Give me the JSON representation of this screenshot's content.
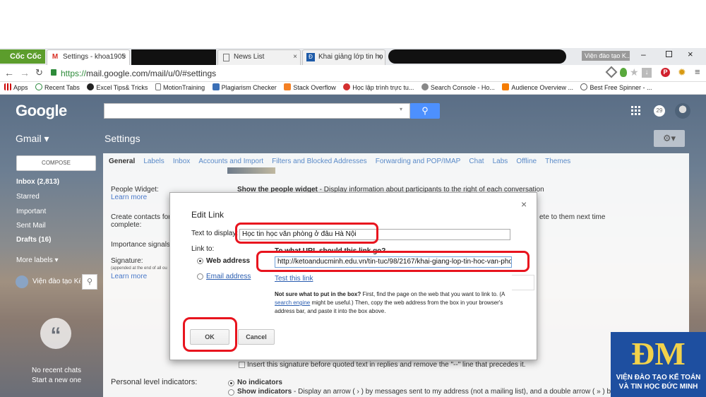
{
  "browser": {
    "tabs": [
      {
        "label": "Cốc Cốc"
      },
      {
        "label": "Settings - khoa1905"
      },
      {
        "label": "News List"
      },
      {
        "label": "Khai giảng lớp tin họ"
      }
    ],
    "profile_chip": "Viện đào tạo K...",
    "url_protocol": "https://",
    "url_rest": "mail.google.com/mail/u/0/#settings",
    "bookmarks": [
      "Apps",
      "Recent Tabs",
      "Excel Tips& Tricks",
      "MotionTraining",
      "Plagiarism Checker",
      "Stack Overflow",
      "Học lập trình trực tu...",
      "Search Console - Ho...",
      "Audience Overview ...",
      "Best Free Spinner - ..."
    ]
  },
  "gmail": {
    "logo": "Google",
    "app_switcher": "Gmail ▾",
    "page_title": "Settings",
    "notif_count": "29",
    "compose": "COMPOSE",
    "nav": [
      "Inbox (2,813)",
      "Starred",
      "Important",
      "Sent Mail",
      "Drafts (16)",
      "More labels ▾"
    ],
    "chat_user": "Viện đào tạo Kế",
    "no_chats": "No recent chats",
    "new_chat": "Start a new one",
    "settings_tabs": [
      "General",
      "Labels",
      "Inbox",
      "Accounts and Import",
      "Filters and Blocked Addresses",
      "Forwarding and POP/IMAP",
      "Chat",
      "Labs",
      "Offline",
      "Themes"
    ],
    "people_widget_label": "People Widget:",
    "people_widget_learn": "Learn more",
    "people_widget_opt_bold": "Show the people widget",
    "people_widget_opt_rest": " - Display information about participants to the right of each conversation",
    "create_contacts_label": "Create contacts for",
    "create_contacts_label2": "complete:",
    "create_contacts_rest": "ete to them next time",
    "importance_label": "Importance signals",
    "signature_label": "Signature:",
    "signature_note": "(appended at the end of all ou",
    "signature_learn": "Learn more",
    "insert_sig": "Insert this signature before quoted text in replies and remove the \"--\" line that precedes it.",
    "personal_label": "Personal level indicators:",
    "no_indicators": "No indicators",
    "show_indicators_bold": "Show indicators",
    "show_indicators_rest": " - Display an arrow ( › ) by messages sent to my address (not a mailing list), and a double arrow ( » ) by mess"
  },
  "dialog": {
    "title": "Edit Link",
    "close": "×",
    "text_label": "Text to display:",
    "text_value": "Học tin học văn phòng ở đâu Hà Nội",
    "link_to": "Link to:",
    "opt_web": "Web address",
    "opt_email": "Email address",
    "question": "To what URL should this link go?",
    "url_value": "http://ketoanducminh.edu.vn/tin-tuc/98/2167/khai-giang-lop-tin-hoc-van-phong-c",
    "test_link": "Test this link",
    "help_bold": "Not sure what to put in the box?",
    "help_1": " First, find the page on the web that you want to link to. (A ",
    "help_link": "search engine",
    "help_2": " might be useful.) Then, copy the web address from the box in your browser's address bar, and paste it into the box above.",
    "ok": "OK",
    "cancel": "Cancel"
  },
  "watermark": {
    "logo": "ĐM",
    "line1": "VIỆN ĐÀO TẠO KẾ TOÁN",
    "line2": "VÀ TIN HỌC ĐỨC MINH"
  }
}
